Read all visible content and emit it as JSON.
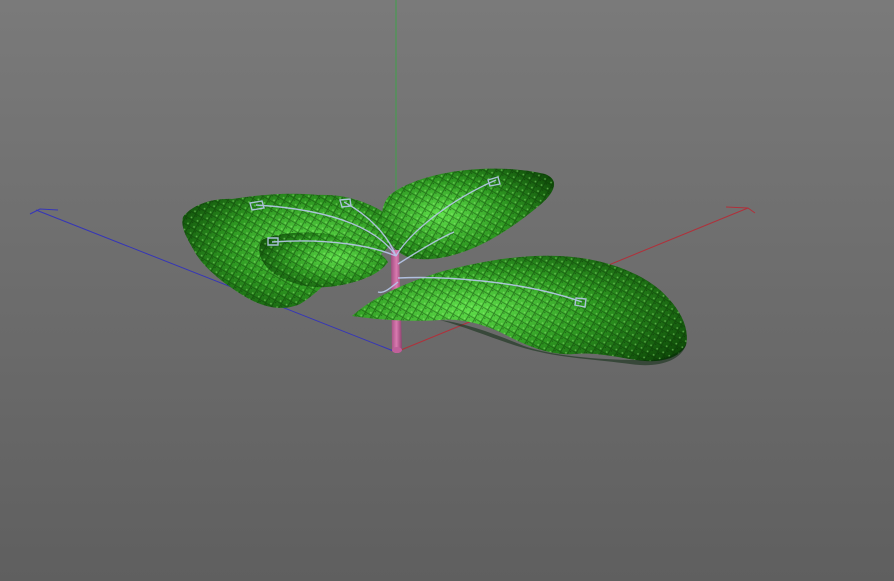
{
  "viewport": {
    "background_top": "#7a7a7a",
    "background_bottom": "#5f5f5f"
  },
  "axes": {
    "x": {
      "name": "x-axis",
      "color": "#b0303a"
    },
    "y": {
      "name": "y-axis",
      "color": "#3fa14a"
    },
    "z": {
      "name": "z-axis",
      "color": "#3535b8"
    }
  },
  "model": {
    "stem_color": "#d97ab0",
    "leaf_dark": "#0e4a08",
    "leaf_mid": "#2f9a22",
    "leaf_light": "#5fe04a",
    "skeleton_color": "#b8c8ec"
  }
}
